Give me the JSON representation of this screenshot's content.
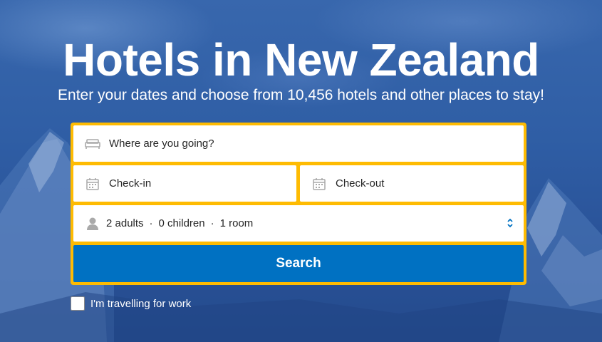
{
  "hero": {
    "title": "Hotels in New Zealand",
    "subtitle": "Enter your dates and choose from 10,456 hotels and other places to stay!"
  },
  "search_form": {
    "destination_placeholder": "Where are you going?",
    "checkin_label": "Check-in",
    "checkout_label": "Check-out",
    "guests": {
      "adults": "2 adults",
      "children": "0 children",
      "rooms": "1 room",
      "separator": "·"
    },
    "search_label": "Search"
  },
  "work_trip": {
    "label": "I'm travelling for work",
    "checked": false
  },
  "icons": {
    "destination": "bed-icon",
    "checkin": "calendar-icon",
    "checkout": "calendar-icon",
    "guests": "person-icon",
    "guests_toggle": "chevron-updown-icon"
  },
  "colors": {
    "form_border": "#febb02",
    "search_button": "#0071c2",
    "text": "#262626"
  }
}
